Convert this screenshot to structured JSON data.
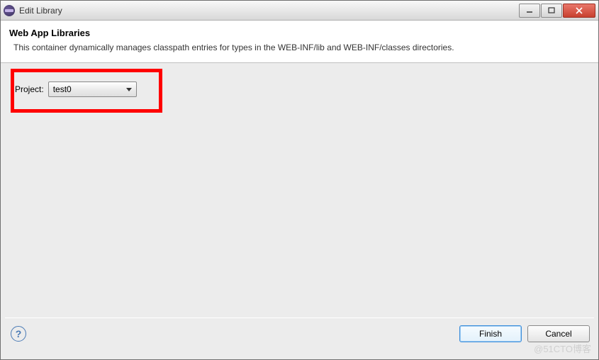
{
  "titlebar": {
    "title": "Edit Library"
  },
  "header": {
    "title": "Web App Libraries",
    "description": "This container dynamically manages classpath entries for types in the WEB-INF/lib and WEB-INF/classes directories."
  },
  "body": {
    "project_label": "Project:",
    "project_value": "test0"
  },
  "footer": {
    "help_symbol": "?",
    "finish_label": "Finish",
    "cancel_label": "Cancel"
  },
  "watermark": "@51CTO博客"
}
